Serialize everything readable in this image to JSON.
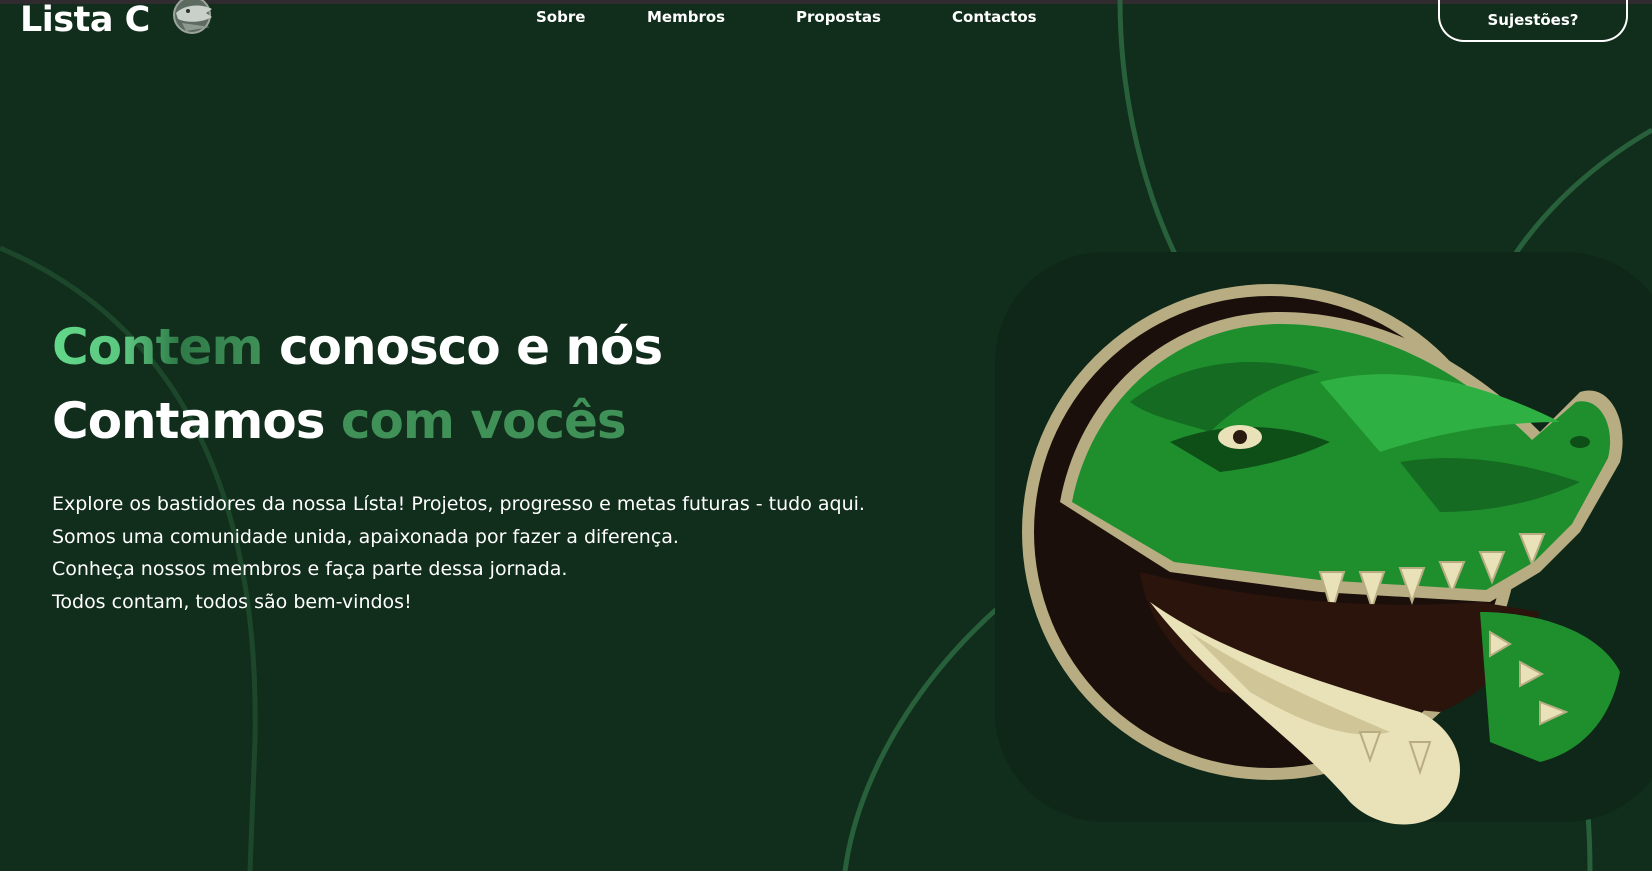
{
  "brand": {
    "logo_text": "Lista C",
    "logo_icon": "crocodile-badge-icon"
  },
  "nav": {
    "items": [
      {
        "label": "Sobre"
      },
      {
        "label": "Membros"
      },
      {
        "label": "Propostas"
      },
      {
        "label": "Contactos"
      }
    ],
    "cta_label": "Sujestões?"
  },
  "hero": {
    "title_line1_highlight": "Contem",
    "title_line1_rest": "conosco e nós",
    "title_line2_start": "Contamos",
    "title_line2_highlight": "com vocês",
    "description_lines": [
      "Explore os bastidores da nossa Lísta! Projetos, progresso e metas futuras - tudo aqui.",
      "Somos uma comunidade unida, apaixonada por fazer a diferença.",
      "Conheça nossos membros e faça parte dessa jornada.",
      "Todos contam, todos são bem-vindos!"
    ]
  },
  "mascot": {
    "icon": "crocodile-mascot-icon"
  },
  "colors": {
    "background": "#112d1b",
    "card": "#0f2718",
    "accent_light": "#63d98a",
    "accent_dark": "#3f9158",
    "decor_lines": "#2c6a3f",
    "mascot_green": "#1f8f2e",
    "mascot_cream": "#e9e1b8",
    "mascot_outline": "#b8ad82"
  }
}
